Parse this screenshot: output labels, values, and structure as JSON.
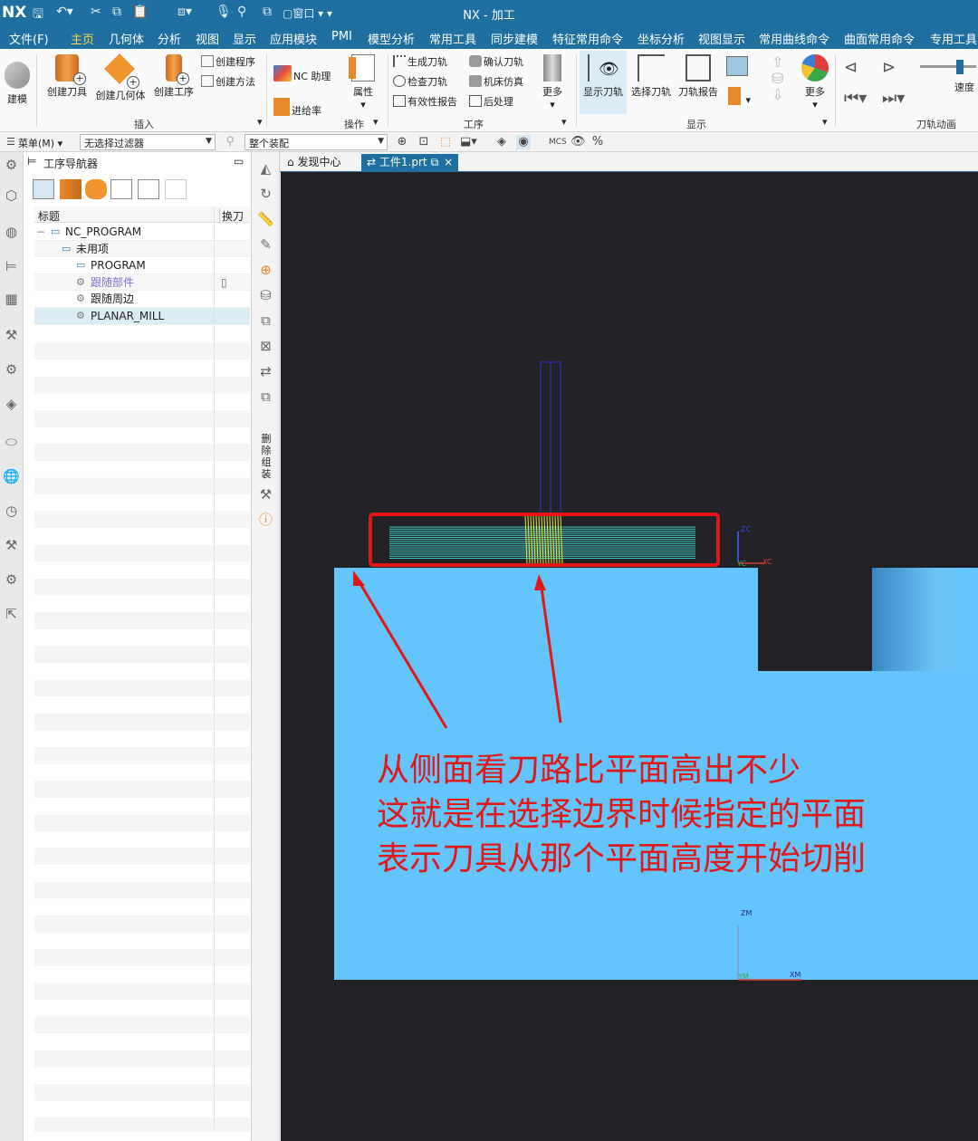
{
  "app": {
    "logo": "NX",
    "title": "NX - 加工",
    "window_menu": "窗口"
  },
  "menu_tabs": [
    "文件(F)",
    "主页",
    "几何体",
    "分析",
    "视图",
    "显示",
    "应用模块",
    "PMI",
    "模型分析",
    "常用工具",
    "同步建模",
    "特征常用命令",
    "坐标分析",
    "视图显示",
    "常用曲线命令",
    "曲面常用命令",
    "专用工具"
  ],
  "active_tab": "主页",
  "ribbon": {
    "build": "建模",
    "create_tool": "创建刀具",
    "create_geometry": "创建几何体",
    "create_operation": "创建工序",
    "create_program": "创建程序",
    "create_method": "创建方法",
    "nc_assistant": "NC 助理",
    "feed_rate": "进给率",
    "properties": "属性",
    "generate_path": "生成刀轨",
    "verify_path": "确认刀轨",
    "check_path": "检查刀轨",
    "machine_sim": "机床仿真",
    "validity_report": "有效性报告",
    "post_process": "后处理",
    "more1": "更多",
    "show_path": "显示刀轨",
    "select_path": "选择刀轨",
    "path_report": "刀轨报告",
    "more2": "更多",
    "speed": "速度",
    "groups": {
      "insert": "插入",
      "operation": "操作",
      "process": "工序",
      "display": "显示",
      "animation": "刀轨动画"
    }
  },
  "filterbar": {
    "menu": "菜单(M)",
    "filter": "无选择过滤器",
    "assembly": "整个装配"
  },
  "navigator": {
    "title": "工序导航器",
    "col_title": "标题",
    "col_tool": "换刀",
    "rows": [
      {
        "label": "NC_PROGRAM",
        "level": 0,
        "color": "#222222"
      },
      {
        "label": "未用项",
        "level": 1,
        "color": "#222222"
      },
      {
        "label": "PROGRAM",
        "level": 2,
        "color": "#222222"
      },
      {
        "label": "跟随部件",
        "level": 2,
        "color": "#7c6fd8"
      },
      {
        "label": "跟随周边",
        "level": 2,
        "color": "#222222"
      },
      {
        "label": "PLANAR_MILL",
        "level": 2,
        "color": "#222222"
      }
    ]
  },
  "vstrip": {
    "vertical_text": "删除组装"
  },
  "viewport_tabs": {
    "discovery": "发现中心",
    "file": "工件1.prt"
  },
  "axes": {
    "wcs_z": "ZC",
    "wcs_y": "YC",
    "wcs_x": "XC",
    "mcs_z": "ZM",
    "mcs_y": "YM",
    "mcs_x": "XM"
  },
  "annotation": {
    "line1": "从侧面看刀路比平面高出不少",
    "line2": "这就是在选择边界时候指定的平面",
    "line3": "表示刀具从那个平面高度开始切削"
  },
  "colors": {
    "title_bar": "#1f6fa0",
    "active_tab_text": "#ffd24a",
    "viewport_bg": "#222226",
    "part": "#64c5fd",
    "toolpath": "#3fc9c9",
    "tool_path_plunge": "#e8e83a",
    "highlight": "#e01818"
  }
}
